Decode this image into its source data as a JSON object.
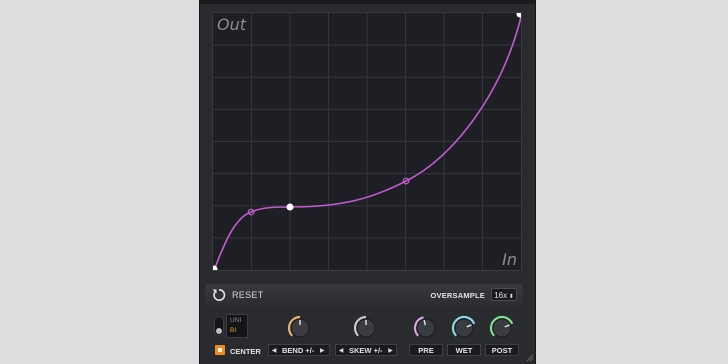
{
  "graph": {
    "output_axis_label": "Out",
    "input_axis_label": "In",
    "curve_color": "#c25bd0",
    "grid_divisions": 8
  },
  "toolbar": {
    "reset_label": "RESET",
    "oversample_label": "OVERSAMPLE",
    "oversample_value": "16x"
  },
  "mode": {
    "options": [
      "UNI",
      "BI"
    ],
    "selected": "BI",
    "active_color": "#f0a030"
  },
  "center": {
    "label": "CENTER",
    "checked": true,
    "color": "#f08a1e"
  },
  "controls": {
    "bend": {
      "label": "BEND +/-",
      "color": "#e8b070",
      "value": 0.5
    },
    "skew": {
      "label": "SKEW +/-",
      "color": "#c8c8c8",
      "value": 0.5
    },
    "pre": {
      "label": "PRE",
      "color": "#d9a6e0",
      "value": 0.45
    },
    "wet": {
      "label": "WET",
      "color": "#8fd6ea",
      "value": 0.75
    },
    "post": {
      "label": "POST",
      "color": "#7fe08f",
      "value": 0.75
    }
  }
}
